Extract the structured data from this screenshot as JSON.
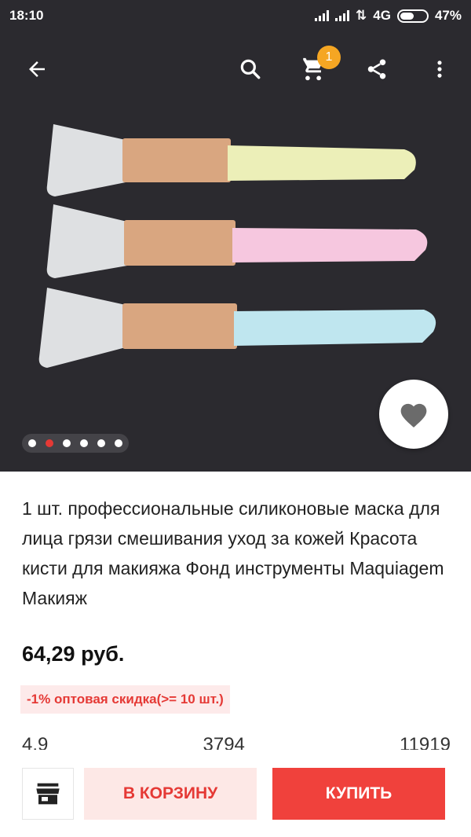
{
  "status_bar": {
    "time": "18:10",
    "network": "4G",
    "battery": "47%"
  },
  "toolbar": {
    "back_icon": "arrow-left-icon",
    "search_icon": "search-icon",
    "cart_icon": "cart-icon",
    "cart_count": "1",
    "share_icon": "share-icon",
    "more_icon": "more-vertical-icon"
  },
  "gallery": {
    "total_images": 6,
    "active_index": 1,
    "brush_handle_colors": [
      "#ecefb8",
      "#f6c7df",
      "#bfe6ef"
    ],
    "ferrule_color": "#d9a680",
    "tip_color": "#eef0f2",
    "favorite_icon": "heart-icon"
  },
  "product": {
    "title": "1 шт. профессиональные силиконовые маска для лица грязи смешивания уход за кожей Красота кисти для макияжа Фонд инструменты Maquiagem Макияж",
    "price": "64,29 руб.",
    "discount": "-1% оптовая скидка(>= 10 шт.)",
    "stats": {
      "rating": "4.9",
      "orders": "3794",
      "wishlist": "11919"
    }
  },
  "bottom_bar": {
    "store_icon": "store-icon",
    "add_to_cart_label": "В КОРЗИНУ",
    "buy_label": "КУПИТЬ"
  },
  "colors": {
    "accent": "#f0413c",
    "accent_light": "#fde8e6",
    "badge": "#f5a623",
    "hero_bg": "#2b2a2f"
  }
}
